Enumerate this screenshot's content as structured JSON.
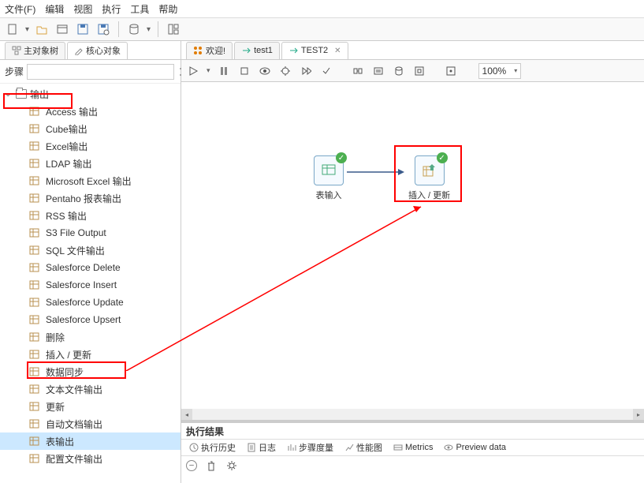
{
  "menu": {
    "file": "文件(F)",
    "edit": "编辑",
    "view": "视图",
    "run": "执行",
    "tools": "工具",
    "help": "帮助"
  },
  "left_tabs": {
    "main_tree": "主对象树",
    "core_objects": "核心对象"
  },
  "filter": {
    "label": "步骤",
    "value": ""
  },
  "tree_folder": "输出",
  "tree_items": [
    "Access 输出",
    "Cube输出",
    "Excel输出",
    "LDAP 输出",
    "Microsoft Excel 输出",
    "Pentaho 报表输出",
    "RSS 输出",
    "S3 File Output",
    "SQL 文件输出",
    "Salesforce Delete",
    "Salesforce Insert",
    "Salesforce Update",
    "Salesforce Upsert",
    "删除",
    "插入 / 更新",
    "数据同步",
    "文本文件输出",
    "更新",
    "自动文档输出",
    "表输出",
    "配置文件输出"
  ],
  "selected_tree_index": 19,
  "editor_tabs": {
    "welcome": "欢迎!",
    "t1": "test1",
    "t2": "TEST2"
  },
  "zoom": "100%",
  "nodes": {
    "input": "表输入",
    "upsert": "插入 / 更新"
  },
  "results": {
    "title": "执行结果",
    "tabs": {
      "history": "执行历史",
      "log": "日志",
      "metrics_step": "步骤度量",
      "perf": "性能图",
      "metrics": "Metrics",
      "preview": "Preview data"
    }
  }
}
